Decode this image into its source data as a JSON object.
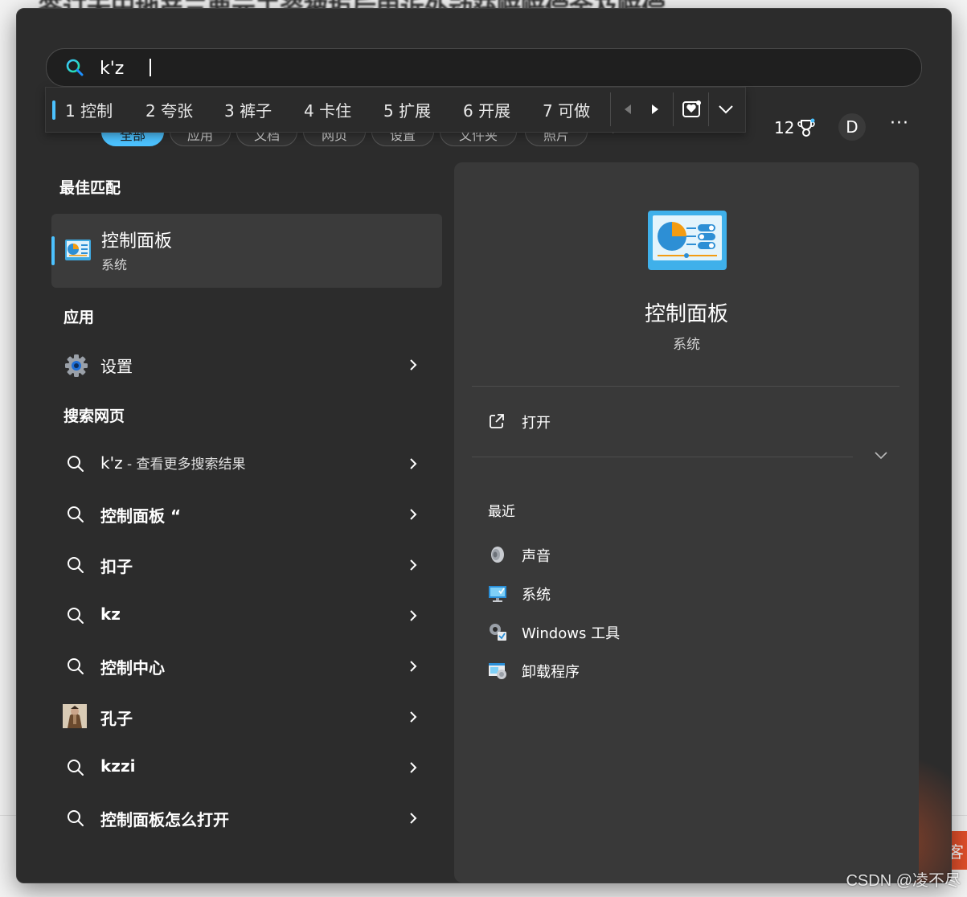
{
  "background": {
    "heading": "签订无田地产三要元工资被拒后申诉外动获赔赔偿金及赔偿",
    "side_tab": "客",
    "watermark": "CSDN @凌不尽"
  },
  "search": {
    "value": "k'z",
    "placeholder": ""
  },
  "ime": {
    "candidates": [
      "1 控制",
      "2 夸张",
      "3 裤子",
      "4 卡住",
      "5 扩展",
      "6 开展",
      "7 可做"
    ]
  },
  "filters": {
    "pills": [
      "全部",
      "应用",
      "文档",
      "网页",
      "设置",
      "文件夹",
      "照片"
    ]
  },
  "header": {
    "points": "12",
    "avatar_initial": "D",
    "more_label": "···"
  },
  "left": {
    "best_match_title": "最佳匹配",
    "best_match": {
      "title": "控制面板",
      "subtitle": "系统"
    },
    "apps_title": "应用",
    "apps": [
      {
        "label": "设置",
        "icon": "gear-icon"
      }
    ],
    "web_title": "搜索网页",
    "web": [
      {
        "label": "k'z",
        "suffix": " - 查看更多搜索结果",
        "bold": false
      },
      {
        "label": "控制面板 “",
        "suffix": "",
        "bold": true
      },
      {
        "label": "扣子",
        "suffix": "",
        "bold": true
      },
      {
        "label": "kz",
        "suffix": "",
        "bold": true
      },
      {
        "label": "控制中心",
        "suffix": "",
        "bold": true
      },
      {
        "label": "孔子",
        "suffix": "",
        "bold": true
      },
      {
        "label": "kzzi",
        "suffix": "",
        "bold": true
      },
      {
        "label": "控制面板怎么打开",
        "suffix": "",
        "bold": true
      }
    ]
  },
  "preview": {
    "title": "控制面板",
    "subtitle": "系统",
    "open_label": "打开",
    "recent_title": "最近",
    "recent": [
      {
        "label": "声音",
        "icon": "speaker-icon"
      },
      {
        "label": "系统",
        "icon": "monitor-icon"
      },
      {
        "label": "Windows 工具",
        "icon": "tools-icon"
      },
      {
        "label": "卸载程序",
        "icon": "uninstall-icon"
      }
    ]
  },
  "colors": {
    "accent": "#4cc2ff",
    "panel": "#2c2c2c",
    "preview_bg": "#393939"
  }
}
